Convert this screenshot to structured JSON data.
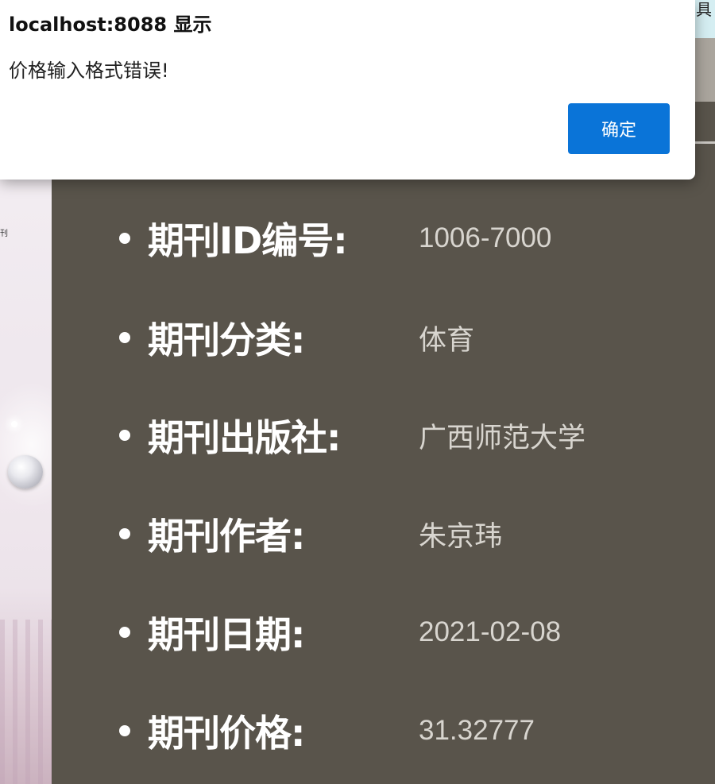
{
  "dialog": {
    "title": "localhost:8088 显示",
    "message": "价格输入格式错误!",
    "ok_label": "确定",
    "button_color": "#0a74d8"
  },
  "background": {
    "header_char": "具",
    "left_tiny_text": "刊"
  },
  "journal": {
    "rows": [
      {
        "label": "期刊ID编号:",
        "value": "1006-7000"
      },
      {
        "label": "期刊分类:",
        "value": "体育"
      },
      {
        "label": "期刊出版社:",
        "value": "广西师范大学"
      },
      {
        "label": "期刊作者:",
        "value": "朱京玮"
      },
      {
        "label": "期刊日期:",
        "value": "2021-02-08"
      },
      {
        "label": "期刊价格:",
        "value": "31.32777"
      }
    ]
  },
  "colors": {
    "page_bg": "#59544b",
    "label_text": "#ffffff",
    "value_text": "#d8d5cf"
  }
}
